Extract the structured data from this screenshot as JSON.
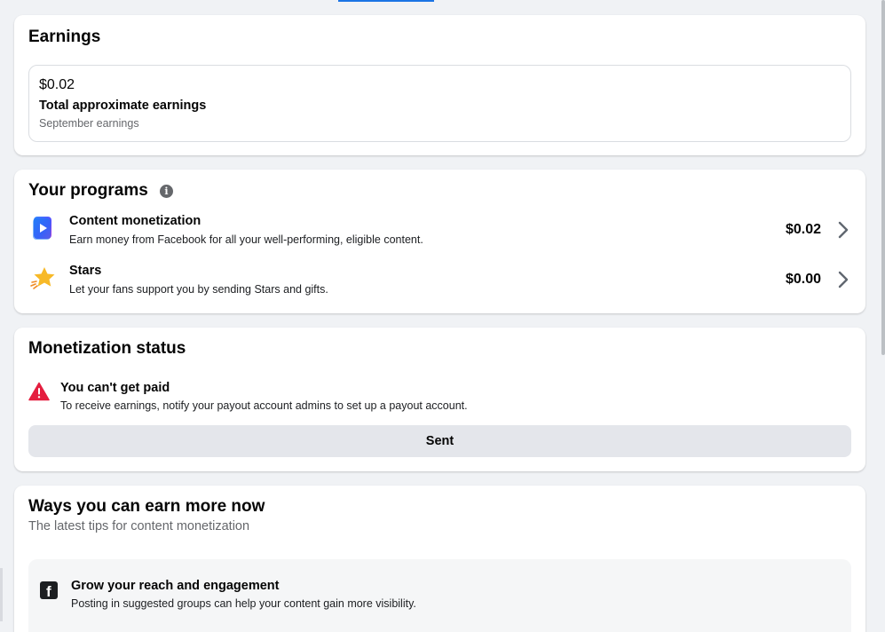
{
  "accent_color": "#1b74e4",
  "earnings": {
    "title": "Earnings",
    "amount": "$0.02",
    "label": "Total approximate earnings",
    "period": "September earnings"
  },
  "programs": {
    "title": "Your programs",
    "info_icon": "info-icon",
    "items": [
      {
        "name": "Content monetization",
        "description": "Earn money from Facebook for all your well-performing, eligible content.",
        "amount": "$0.02",
        "icon": "play-icon"
      },
      {
        "name": "Stars",
        "description": "Let your fans support you by sending Stars and gifts.",
        "amount": "$0.00",
        "icon": "star-icon"
      }
    ]
  },
  "status": {
    "title": "Monetization status",
    "alert_title": "You can't get paid",
    "alert_description": "To receive earnings, notify your payout account admins to set up a payout account.",
    "button_label": "Sent",
    "alert_color": "#e41e3f"
  },
  "ways": {
    "title": "Ways you can earn more now",
    "subtitle": "The latest tips for content monetization",
    "tip": {
      "title": "Grow your reach and engagement",
      "description": "Posting in suggested groups can help your content gain more visibility.",
      "icon": "facebook-icon"
    }
  }
}
